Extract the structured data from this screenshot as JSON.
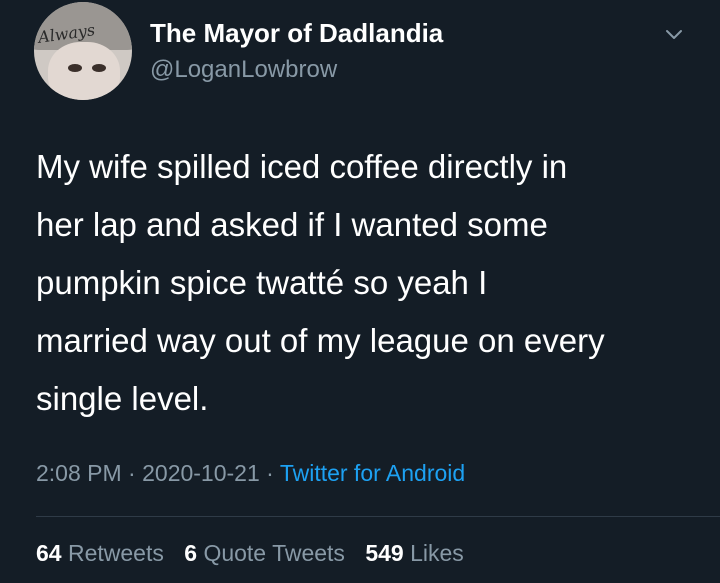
{
  "user": {
    "display_name": "The Mayor of Dadlandia",
    "handle": "@LoganLowbrow",
    "avatar_text": "Always"
  },
  "tweet": {
    "lines": [
      "My wife spilled iced coffee directly in",
      "her lap and asked if I wanted some",
      "pumpkin spice twatté so yeah I",
      "married way out of my league on every",
      "single level."
    ]
  },
  "meta": {
    "time": "2:08 PM",
    "separator": "·",
    "date": "2020-10-21",
    "source": "Twitter for Android"
  },
  "stats": {
    "retweets_count": "64",
    "retweets_label": "Retweets",
    "quotes_count": "6",
    "quotes_label": "Quote Tweets",
    "likes_count": "549",
    "likes_label": "Likes"
  },
  "icons": {
    "chevron": "chevron-down-icon"
  },
  "colors": {
    "background": "#141d26",
    "secondary_text": "#8899a6",
    "link": "#1da1f2"
  }
}
